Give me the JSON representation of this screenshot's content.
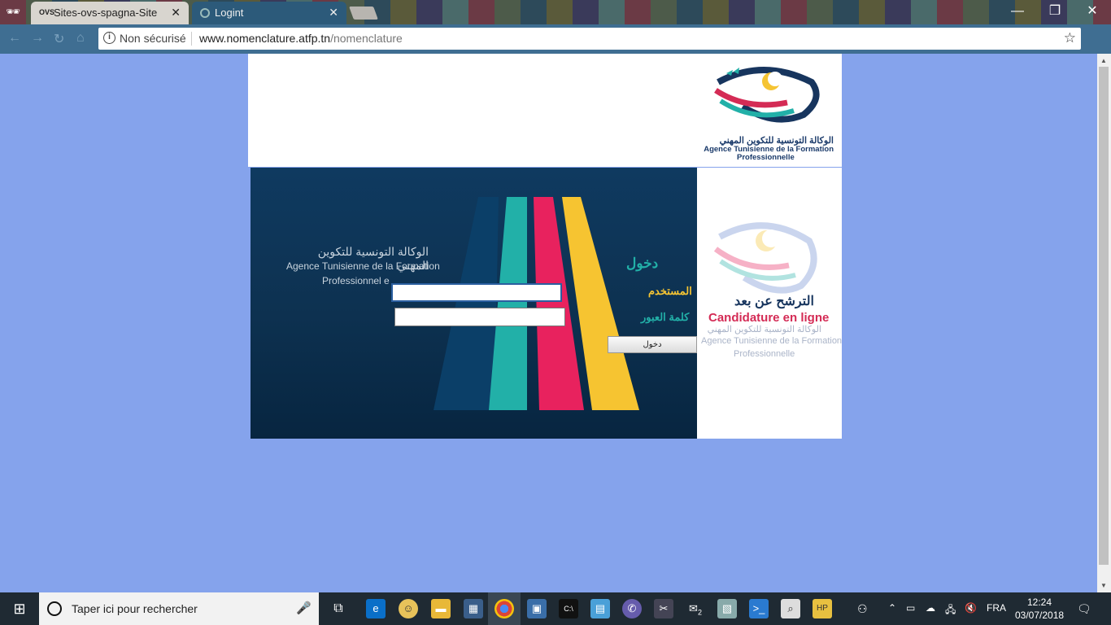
{
  "browser": {
    "tabs": [
      {
        "label": "Sites-ovs-spagna-Site",
        "favicon": "OVS"
      },
      {
        "label": "Logint"
      }
    ],
    "close_glyph": "✕",
    "window_controls": {
      "minimize": "—",
      "maximize": "❐",
      "close": "✕"
    },
    "address": {
      "security_label": "Non sécurisé",
      "host": "www.nomenclature.atfp.tn",
      "path": "/nomenclature"
    }
  },
  "page": {
    "header_logo": {
      "arabic": "الوكالة التونسية للتكوين المهني",
      "french_line1": "Agence Tunisienne de la Formation",
      "french_line2": "Professionnelle"
    },
    "login": {
      "background_arabic": "الوكالة التونسية للتكوين المهني",
      "background_french_line1": "Agence Tunisienne de la Formation",
      "background_french_line2": "Professionnel e",
      "title": "دخول",
      "username_label": "المستخدم",
      "password_label": "كلمة العبور",
      "username_value": "",
      "password_value": "",
      "submit_label": "دخول"
    },
    "side": {
      "candidature_arabic": "الترشح عن بعد",
      "candidature_french": "Candidature en ligne",
      "faded_arabic": "الوكالة التونسية للتكوين المهني",
      "faded_french_line1": "Agence Tunisienne de la Formation",
      "faded_french_line2": "Professionnelle"
    }
  },
  "taskbar": {
    "search_placeholder": "Taper ici pour rechercher",
    "language": "FRA",
    "time": "12:24",
    "date": "03/07/2018",
    "mail_badge": "2"
  },
  "colors": {
    "page_background": "#85a3ec",
    "teal": "#22b0a8",
    "yellow": "#f5c433",
    "crimson": "#d42b55",
    "navy": "#17355e"
  }
}
